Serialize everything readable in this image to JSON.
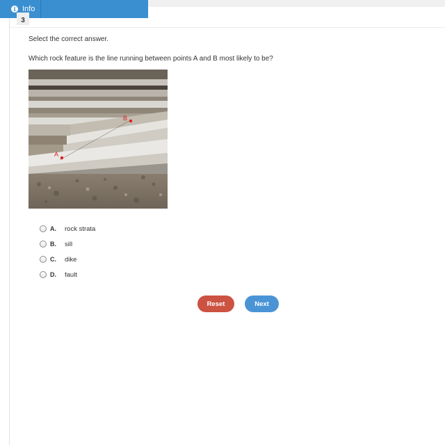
{
  "header": {
    "info_label": "Info",
    "info_icon": "info-circle-icon"
  },
  "question": {
    "number": "3",
    "instruction": "Select the correct answer.",
    "prompt": "Which rock feature is the line running between points A and B most likely to be?",
    "image": {
      "point_a_label": "A",
      "point_b_label": "B"
    }
  },
  "choices": [
    {
      "letter": "A.",
      "text": "rock strata"
    },
    {
      "letter": "B.",
      "text": "sill"
    },
    {
      "letter": "C.",
      "text": "dike"
    },
    {
      "letter": "D.",
      "text": "fault"
    }
  ],
  "buttons": {
    "reset_label": "Reset",
    "next_label": "Next"
  },
  "colors": {
    "info_bar": "#3a8fd1",
    "reset": "#cc5242",
    "next": "#4a94d6",
    "marker": "#e02020"
  }
}
